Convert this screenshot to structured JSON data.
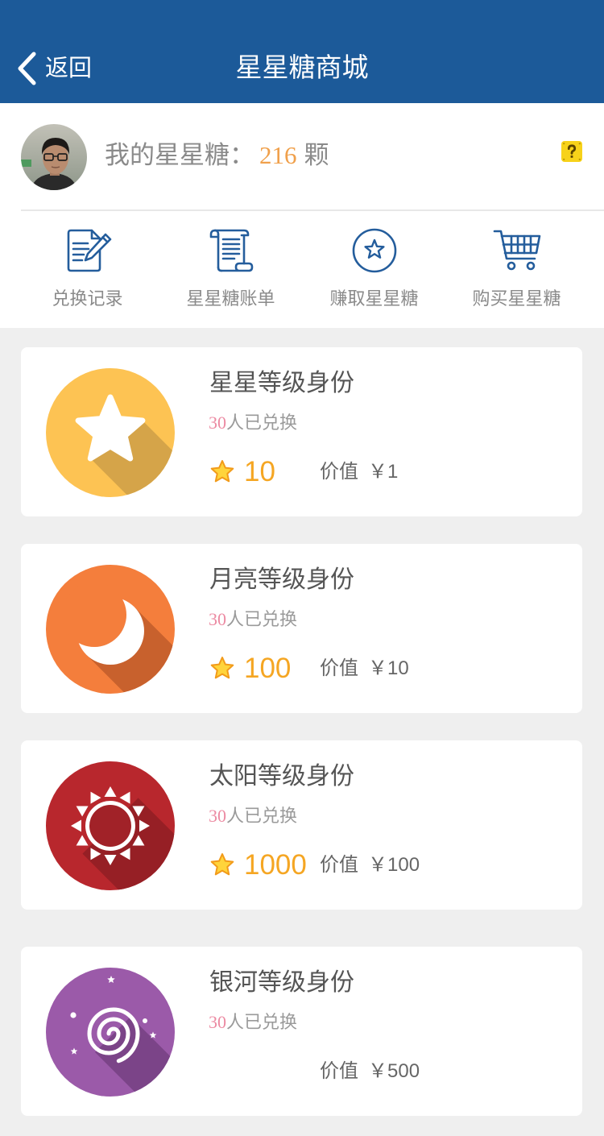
{
  "header": {
    "back_label": "返回",
    "back_icon": "chevron-left-icon",
    "title": "星星糖商城"
  },
  "account": {
    "label": "我的星星糖：",
    "count": "216",
    "unit": "颗",
    "help_icon": "question-icon"
  },
  "shortcuts": [
    {
      "label": "兑换记录",
      "icon": "document-edit-icon"
    },
    {
      "label": "星星糖账单",
      "icon": "scroll-icon"
    },
    {
      "label": "赚取星星糖",
      "icon": "star-circle-icon"
    },
    {
      "label": "购买星星糖",
      "icon": "shopping-cart-icon"
    }
  ],
  "products": [
    {
      "title": "星星等级身份",
      "redeemed_count": "30",
      "redeemed_text": "人已兑换",
      "star_price": "10",
      "value_label": "价值",
      "value": "￥1",
      "icon": "star-badge-icon",
      "badge_color": "#fdc353",
      "shadow_color": "#d5a449"
    },
    {
      "title": "月亮等级身份",
      "redeemed_count": "30",
      "redeemed_text": "人已兑换",
      "star_price": "100",
      "value_label": "价值",
      "value": "￥10",
      "icon": "moon-badge-icon",
      "badge_color": "#f47e3c",
      "shadow_color": "#c8612d"
    },
    {
      "title": "太阳等级身份",
      "redeemed_count": "30",
      "redeemed_text": "人已兑换",
      "star_price": "1000",
      "value_label": "价值",
      "value": "￥100",
      "icon": "sun-badge-icon",
      "badge_color": "#b8272d",
      "shadow_color": "#961f25"
    },
    {
      "title": "银河等级身份",
      "redeemed_count": "30",
      "redeemed_text": "人已兑换",
      "value_label": "价值",
      "value": "￥500",
      "icon": "galaxy-badge-icon",
      "badge_color": "#9b5aa9",
      "shadow_color": "#7b4488"
    }
  ],
  "colors": {
    "nav_bar": "#1c5a99",
    "icon_blue": "#245d9c",
    "balance_orange": "#f0a04b",
    "price_orange": "#f5a623",
    "count_pink": "#ec8aa2",
    "page_background": "#efefef"
  }
}
